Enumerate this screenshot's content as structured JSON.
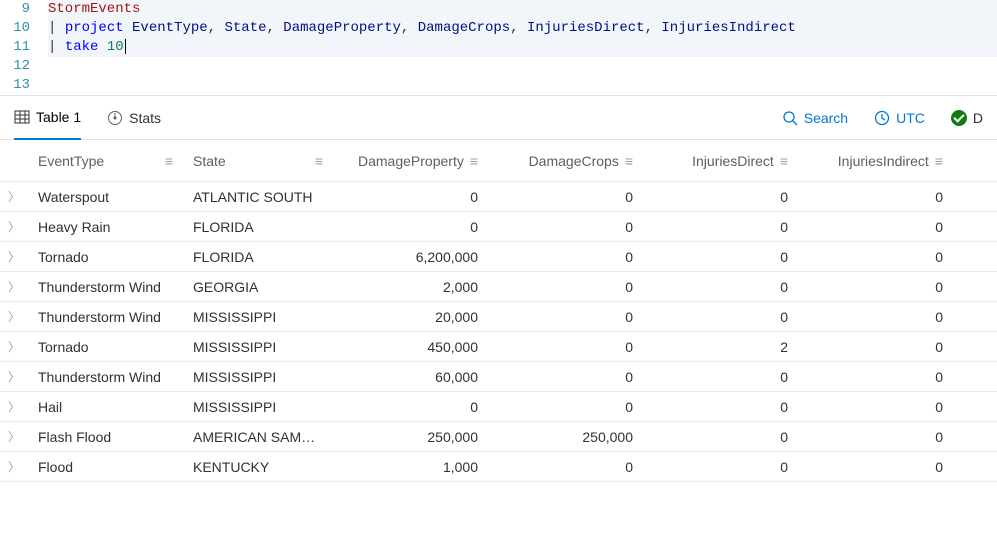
{
  "editor": {
    "lines": [
      {
        "num": 9
      },
      {
        "num": 10
      },
      {
        "num": 11
      },
      {
        "num": 12
      },
      {
        "num": 13
      }
    ],
    "tokens": {
      "table": "StormEvents",
      "pipe": "|",
      "project": "project",
      "cols": [
        "EventType",
        "State",
        "DamageProperty",
        "DamageCrops",
        "InjuriesDirect",
        "InjuriesIndirect"
      ],
      "take": "take",
      "take_n": "10",
      "comma": ", "
    }
  },
  "toolbar": {
    "tab_table": "Table 1",
    "tab_stats": "Stats",
    "search": "Search",
    "utc": "UTC",
    "done": "D"
  },
  "columns": {
    "event": "EventType",
    "state": "State",
    "dprop": "DamageProperty",
    "dcrop": "DamageCrops",
    "injd": "InjuriesDirect",
    "inji": "InjuriesIndirect"
  },
  "rows": [
    {
      "event": "Waterspout",
      "state": "ATLANTIC SOUTH",
      "dprop": "0",
      "dcrop": "0",
      "injd": "0",
      "inji": "0"
    },
    {
      "event": "Heavy Rain",
      "state": "FLORIDA",
      "dprop": "0",
      "dcrop": "0",
      "injd": "0",
      "inji": "0"
    },
    {
      "event": "Tornado",
      "state": "FLORIDA",
      "dprop": "6,200,000",
      "dcrop": "0",
      "injd": "0",
      "inji": "0"
    },
    {
      "event": "Thunderstorm Wind",
      "state": "GEORGIA",
      "dprop": "2,000",
      "dcrop": "0",
      "injd": "0",
      "inji": "0"
    },
    {
      "event": "Thunderstorm Wind",
      "state": "MISSISSIPPI",
      "dprop": "20,000",
      "dcrop": "0",
      "injd": "0",
      "inji": "0"
    },
    {
      "event": "Tornado",
      "state": "MISSISSIPPI",
      "dprop": "450,000",
      "dcrop": "0",
      "injd": "2",
      "inji": "0"
    },
    {
      "event": "Thunderstorm Wind",
      "state": "MISSISSIPPI",
      "dprop": "60,000",
      "dcrop": "0",
      "injd": "0",
      "inji": "0"
    },
    {
      "event": "Hail",
      "state": "MISSISSIPPI",
      "dprop": "0",
      "dcrop": "0",
      "injd": "0",
      "inji": "0"
    },
    {
      "event": "Flash Flood",
      "state": "AMERICAN SAM…",
      "dprop": "250,000",
      "dcrop": "250,000",
      "injd": "0",
      "inji": "0"
    },
    {
      "event": "Flood",
      "state": "KENTUCKY",
      "dprop": "1,000",
      "dcrop": "0",
      "injd": "0",
      "inji": "0"
    }
  ],
  "chart_data": {
    "type": "table",
    "columns": [
      "EventType",
      "State",
      "DamageProperty",
      "DamageCrops",
      "InjuriesDirect",
      "InjuriesIndirect"
    ],
    "rows": [
      [
        "Waterspout",
        "ATLANTIC SOUTH",
        0,
        0,
        0,
        0
      ],
      [
        "Heavy Rain",
        "FLORIDA",
        0,
        0,
        0,
        0
      ],
      [
        "Tornado",
        "FLORIDA",
        6200000,
        0,
        0,
        0
      ],
      [
        "Thunderstorm Wind",
        "GEORGIA",
        2000,
        0,
        0,
        0
      ],
      [
        "Thunderstorm Wind",
        "MISSISSIPPI",
        20000,
        0,
        0,
        0
      ],
      [
        "Tornado",
        "MISSISSIPPI",
        450000,
        0,
        2,
        0
      ],
      [
        "Thunderstorm Wind",
        "MISSISSIPPI",
        60000,
        0,
        0,
        0
      ],
      [
        "Hail",
        "MISSISSIPPI",
        0,
        0,
        0,
        0
      ],
      [
        "Flash Flood",
        "AMERICAN SAM…",
        250000,
        250000,
        0,
        0
      ],
      [
        "Flood",
        "KENTUCKY",
        1000,
        0,
        0,
        0
      ]
    ]
  }
}
